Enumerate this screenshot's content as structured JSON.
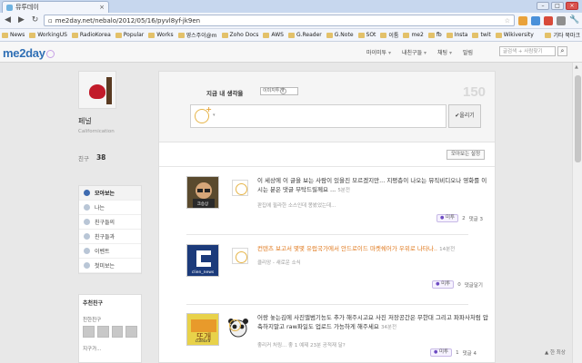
{
  "browser": {
    "tab_title": "뮤투데이",
    "tab_close": "×",
    "url": "me2day.net/nebalo/2012/05/16/pyvl8yf-jk9en",
    "window_controls": [
      "–",
      "□",
      "×"
    ],
    "bookmarks": [
      "News",
      "WorkingUS",
      "RadioKorea",
      "Popular",
      "Works",
      "영스주이@m",
      "Zoho Docs",
      "AWS",
      "G.Reader",
      "G.Note",
      "SOt",
      "이툼",
      "me2",
      "fb",
      "Insta",
      "twit",
      "Wikiversity"
    ],
    "other_bookmarks": "기타 북마크"
  },
  "header": {
    "logo": "me2day",
    "nav": [
      "마이미투",
      "내친구들",
      "채팅",
      "말림"
    ],
    "search_placeholder": "글검색 + 사람찾기"
  },
  "profile": {
    "name": "페널",
    "location": "Californication",
    "friends_label": "친구",
    "friends_count": "38"
  },
  "menu": [
    "모아보는",
    "나는",
    "친구들의",
    "친구들과",
    "이벤트",
    "첫미보는"
  ],
  "recommend": {
    "title": "추천친구",
    "friends_label": "친한친구",
    "more_label": "지구가..."
  },
  "compose": {
    "question": "지금 내 생각을",
    "selector": "이미지투게",
    "help": "?",
    "count": "150",
    "post_button": "✔올리기",
    "dropdown": "▾"
  },
  "settings_button": "모아보는 설정",
  "posts": [
    {
      "avatar_label": "크승상",
      "text": "이 세상에 이 글을 보는 사람이 있을진 모르겠지만... 지평층이 나오는 뮤직비디오나 영화를 이시는 분은 댓글 부탁드릴께요 ...",
      "time": "5분전",
      "meta": "판집에 필라한 소스인데 몽봤었는데...",
      "me2_label": "미투",
      "me2_count": "2",
      "comment_label": "댓글 3"
    },
    {
      "avatar_label": "clien_news",
      "text": "컨텐츠 보고서 몇몇 유럽국가에서 안드로이드 마켓쉐어가 우위로 나타나..",
      "time": "14분전",
      "meta": "클리앙 - 새로운 소식",
      "me2_label": "미투",
      "me2_count": "0",
      "comment_label": "댓글달기"
    },
    {
      "avatar_label": "culebra",
      "text": "어랑 놓는김에 사진앨범기능도 추가 해주시고요 사진 저장공간은 무한대 그리고 파파사처럼 압축하지말고 raw파일도 업로드 가능하게 해주세요",
      "time": "34분전",
      "meta": "좋리커 처링... 좋 1 예제 23분 공적재 달?",
      "me2_label": "미투",
      "me2_count": "1",
      "comment_label": "댓글 4"
    }
  ],
  "to_top": "▲ 한 최상"
}
